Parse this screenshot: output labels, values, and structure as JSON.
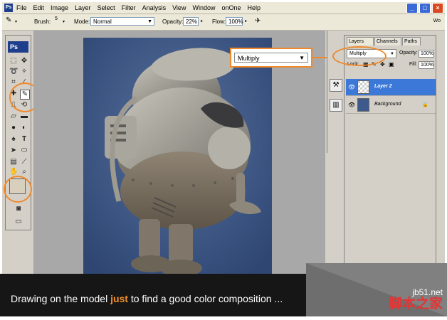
{
  "menu": {
    "items": [
      "File",
      "Edit",
      "Image",
      "Layer",
      "Select",
      "Filter",
      "Analysis",
      "View",
      "Window",
      "onOne",
      "Help"
    ],
    "right_label": "Wo"
  },
  "options_bar": {
    "brush_label": "Brush:",
    "brush_size": "5",
    "mode_label": "Mode:",
    "mode_value": "Normal",
    "opacity_label": "Opacity:",
    "opacity_value": "22%",
    "flow_label": "Flow:",
    "flow_value": "100%"
  },
  "toolbox": {
    "logo": "Ps",
    "foreground_color": "#d8cfbd"
  },
  "callout": {
    "blend_mode": "Multiply"
  },
  "layers_panel": {
    "tabs": [
      "Layers",
      "Channels",
      "Paths"
    ],
    "active_tab": "Layers",
    "blend_mode": "Multiply",
    "opacity_label": "Opacity:",
    "opacity_value": "100%",
    "lock_label": "Lock:",
    "fill_label": "Fill:",
    "fill_value": "100%",
    "layers": [
      {
        "name": "Layer 2",
        "selected": true
      },
      {
        "name": "Background",
        "selected": false,
        "locked": true
      }
    ]
  },
  "caption": {
    "before": "Drawing on the model ",
    "highlight": "just",
    "after": " to find a good color composition ..."
  },
  "watermark": {
    "url": "jb51.net",
    "chinese": "脚本之家"
  },
  "colors": {
    "accent": "#f0892a",
    "highlight_text": "#f28e2b",
    "selected_layer": "#3b78d8",
    "canvas_bg": "#3e5a8a"
  }
}
